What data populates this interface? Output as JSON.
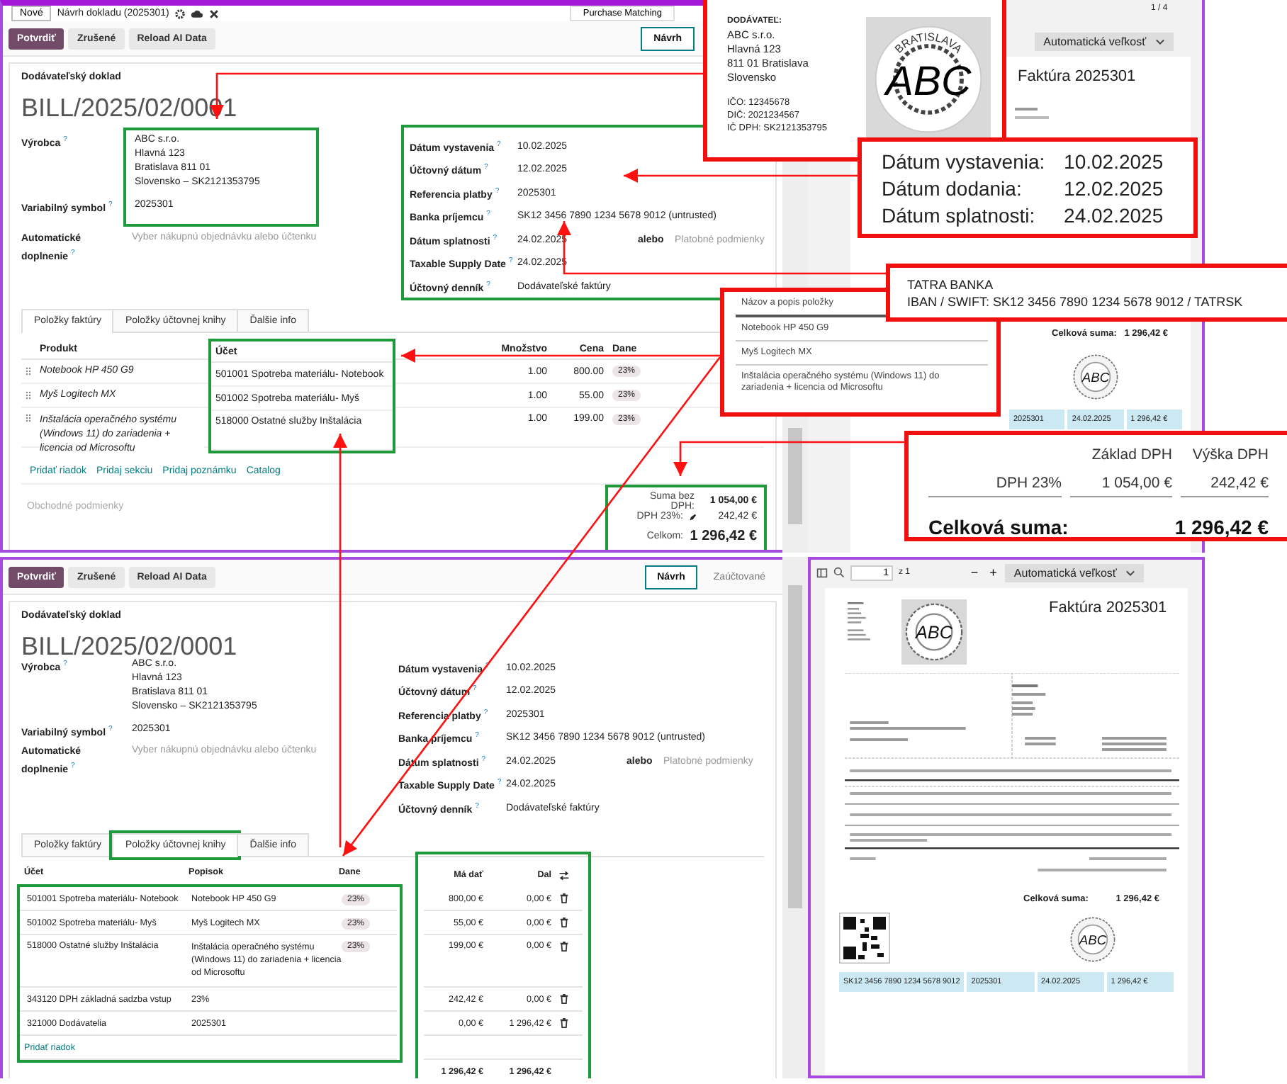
{
  "panels": [
    {
      "breadcrumb": {
        "new_button": "Nové",
        "title": "Návrh dokladu (2025301)",
        "purchase_matching": "Purchase Matching"
      },
      "actions": [
        {
          "label": "Potvrdiť",
          "primary": true
        },
        {
          "label": "Zrušené",
          "primary": false
        },
        {
          "label": "Reload AI Data",
          "primary": false
        }
      ],
      "status_steps": [
        {
          "label": "Návrh",
          "selected": true
        }
      ],
      "doc_type": "Dodávateľský doklad",
      "number": "BILL/2025/02/0001",
      "left_fields": [
        {
          "label": "Výrobca",
          "help": "?",
          "values": [
            "ABC s.r.o.",
            "Hlavná 123",
            "Bratislava 811 01",
            "Slovensko – SK2121353795"
          ],
          "highlighted": true
        },
        {
          "label": "Variabilný symbol",
          "help": "?",
          "values": [
            "2025301"
          ],
          "highlighted": true
        },
        {
          "label": "Automatické doplnenie",
          "help": "?",
          "placeholder": "Vyber nákupnú objednávku alebo účtenku"
        }
      ],
      "right_fields_highlighted": true,
      "right_fields": [
        {
          "label": "Dátum vystavenia",
          "help": "?",
          "value": "10.02.2025"
        },
        {
          "label": "Účtovný dátum",
          "help": "?",
          "value": "12.02.2025"
        },
        {
          "label": "Referencia platby",
          "help": "?",
          "value": "2025301"
        },
        {
          "label": "Banka príjemcu",
          "help": "?",
          "value": "SK12 3456 7890 1234 5678 9012 (untrusted)"
        },
        {
          "label": "Dátum splatnosti",
          "help": "?",
          "value": "24.02.2025",
          "extra_label": "alebo",
          "extra_placeholder": "Platobné podmienky"
        },
        {
          "label": "Taxable Supply Date",
          "help": "?",
          "value": "24.02.2025"
        },
        {
          "label": "Účtovný denník",
          "help": "?",
          "value": "Dodávateľské faktúry"
        }
      ],
      "tabs": [
        {
          "label": "Položky faktúry",
          "selected": true,
          "highlighted": false
        },
        {
          "label": "Položky účtovnej knihy",
          "selected": false,
          "highlighted": false
        },
        {
          "label": "Ďalšie info",
          "selected": false,
          "highlighted": false
        }
      ],
      "table": {
        "kind": "invoice_lines",
        "columns": [
          "Produkt",
          "Účet",
          "Množstvo",
          "Cena",
          "Dane"
        ],
        "account_highlighted": true,
        "rows": [
          {
            "product": "Notebook HP 450 G9",
            "account": "501001 Spotreba materiálu- Notebook",
            "quantity": "1.00",
            "price": "800.00",
            "tax": "23%"
          },
          {
            "product": "Myš Logitech MX",
            "account": "501002 Spotreba materiálu- Myš",
            "quantity": "1.00",
            "price": "55.00",
            "tax": "23%"
          },
          {
            "product": "Inštalácia operačného systému (Windows 11) do zariadenia + licencia od Microsoftu",
            "account": "518000 Ostatné služby Inštalácia",
            "quantity": "1.00",
            "price": "199.00",
            "tax": "23%"
          }
        ],
        "add_links": [
          "Pridať riadok",
          "Pridaj sekciu",
          "Pridaj poznámku",
          "Catalog"
        ],
        "terms_placeholder": "Obchodné podmienky",
        "totals_highlighted": true,
        "totals": [
          {
            "label": "Suma bez DPH:",
            "value": "1 054,00 €",
            "kind": "bold"
          },
          {
            "label": "DPH 23%:",
            "value": "242,42 €",
            "kind": "editable"
          },
          {
            "label": "Celkom:",
            "value": "1 296,42 €",
            "kind": "grand"
          }
        ]
      },
      "viewer": {
        "kind": "partial",
        "page_count": "1 / 4",
        "zoom": "Automatická veľkosť",
        "title": "Faktúra 2025301",
        "total_label": "Celková suma:",
        "total_value": "1 296,42 €",
        "stamp": "ABC",
        "strip": [
          "2025301",
          "24.02.2025",
          "1 296,42 €"
        ]
      }
    },
    {
      "actions": [
        {
          "label": "Potvrdiť",
          "primary": true
        },
        {
          "label": "Zrušené",
          "primary": false
        },
        {
          "label": "Reload AI Data",
          "primary": false
        }
      ],
      "status_steps": [
        {
          "label": "Návrh",
          "selected": true
        },
        {
          "label": "Zaúčtované",
          "selected": false
        }
      ],
      "doc_type": "Dodávateľský doklad",
      "number": "BILL/2025/02/0001",
      "left_fields": [
        {
          "label": "Výrobca",
          "help": "?",
          "values": [
            "ABC s.r.o.",
            "Hlavná 123",
            "Bratislava 811 01",
            "Slovensko – SK2121353795"
          ]
        },
        {
          "label": "Variabilný symbol",
          "help": "?",
          "values": [
            "2025301"
          ]
        },
        {
          "label": "Automatické doplnenie",
          "help": "?",
          "placeholder": "Vyber nákupnú objednávku alebo účtenku"
        }
      ],
      "right_fields": [
        {
          "label": "Dátum vystavenia",
          "help": "?",
          "value": "10.02.2025"
        },
        {
          "label": "Účtovný dátum",
          "help": "?",
          "value": "12.02.2025"
        },
        {
          "label": "Referencia platby",
          "help": "?",
          "value": "2025301"
        },
        {
          "label": "Banka príjemcu",
          "help": "?",
          "value": "SK12 3456 7890 1234 5678 9012 (untrusted)"
        },
        {
          "label": "Dátum splatnosti",
          "help": "?",
          "value": "24.02.2025",
          "extra_label": "alebo",
          "extra_placeholder": "Platobné podmienky"
        },
        {
          "label": "Taxable Supply Date",
          "help": "?",
          "value": "24.02.2025"
        },
        {
          "label": "Účtovný denník",
          "help": "?",
          "value": "Dodávateľské faktúry"
        }
      ],
      "tabs": [
        {
          "label": "Položky faktúry",
          "selected": false,
          "highlighted": false
        },
        {
          "label": "Položky účtovnej knihy",
          "selected": true,
          "highlighted": true
        },
        {
          "label": "Ďalšie info",
          "selected": false,
          "highlighted": false
        }
      ],
      "table": {
        "kind": "journal_items",
        "columns": [
          "Účet",
          "Popisok",
          "Dane",
          "Má dať",
          "Dal"
        ],
        "lines_highlighted": true,
        "amounts_highlighted": true,
        "rows": [
          {
            "account": "501001 Spotreba materiálu- Notebook",
            "label": "Notebook HP 450 G9",
            "tax": "23%",
            "debit": "800,00 €",
            "credit": "0,00 €"
          },
          {
            "account": "501002 Spotreba materiálu- Myš",
            "label": "Myš Logitech MX",
            "tax": "23%",
            "debit": "55,00 €",
            "credit": "0,00 €"
          },
          {
            "account": "518000 Ostatné služby Inštalácia",
            "label": "Inštalácia operačného systému (Windows 11) do zariadenia + licencia od Microsoftu",
            "tax": "23%",
            "debit": "199,00 €",
            "credit": "0,00 €"
          },
          {
            "account": "343120 DPH základná sadzba vstup",
            "label": "23%",
            "debit": "242,42 €",
            "credit": "0,00 €"
          },
          {
            "account": "321000 Dodávatelia",
            "label": "2025301",
            "debit": "0,00 €",
            "credit": "1 296,42 €"
          }
        ],
        "add_link": "Pridať riadok",
        "total_debit": "1 296,42 €",
        "total_credit": "1 296,42 €"
      },
      "viewer": {
        "kind": "full",
        "page_number": "1",
        "page_of": "z 1",
        "zoom_out": "−",
        "zoom_in": "+",
        "zoom": "Automatická veľkosť",
        "supplier_stamp": "ABC",
        "title": "Faktúra 2025301",
        "total_label": "Celková suma:",
        "total_value": "1 296,42 €",
        "stamp": "ABC",
        "strip": [
          "SK12 3456 7890 1234 5678 9012",
          "2025301",
          "24.02.2025",
          "1 296,42 €"
        ]
      }
    }
  ],
  "callouts": {
    "supplier": {
      "heading": "DODÁVATEĽ:",
      "lines": [
        "ABC s.r.o.",
        "Hlavná 123",
        "811 01 Bratislava",
        "Slovensko"
      ],
      "ids": [
        "IČO: 12345678",
        "DIČ: 2021234567",
        "IČ DPH: SK2121353795"
      ],
      "stamp": "ABC",
      "stamp_ring": "BRATISLAVA"
    },
    "dates": [
      {
        "label": "Dátum vystavenia:",
        "value": "10.02.2025"
      },
      {
        "label": "Dátum dodania:",
        "value": "12.02.2025"
      },
      {
        "label": "Dátum splatnosti:",
        "value": "24.02.2025"
      }
    ],
    "bank": {
      "name": "TATRA BANKA",
      "iban": "IBAN / SWIFT: SK12 3456 7890 1234 5678 9012 / TATRSK"
    },
    "items": {
      "header": "Názov a popis položky",
      "rows": [
        "Notebook HP 450 G9",
        "Myš Logitech MX",
        "Inštalácia operačného systému (Windows 11) do zariadenia + licencia od Microsoftu"
      ]
    },
    "tax": {
      "columns": [
        "Základ DPH",
        "Výška DPH"
      ],
      "label": "DPH 23%",
      "base": "1 054,00 €",
      "amount": "242,42 €",
      "total_label": "Celková suma:",
      "total_value": "1 296,42 €"
    }
  }
}
